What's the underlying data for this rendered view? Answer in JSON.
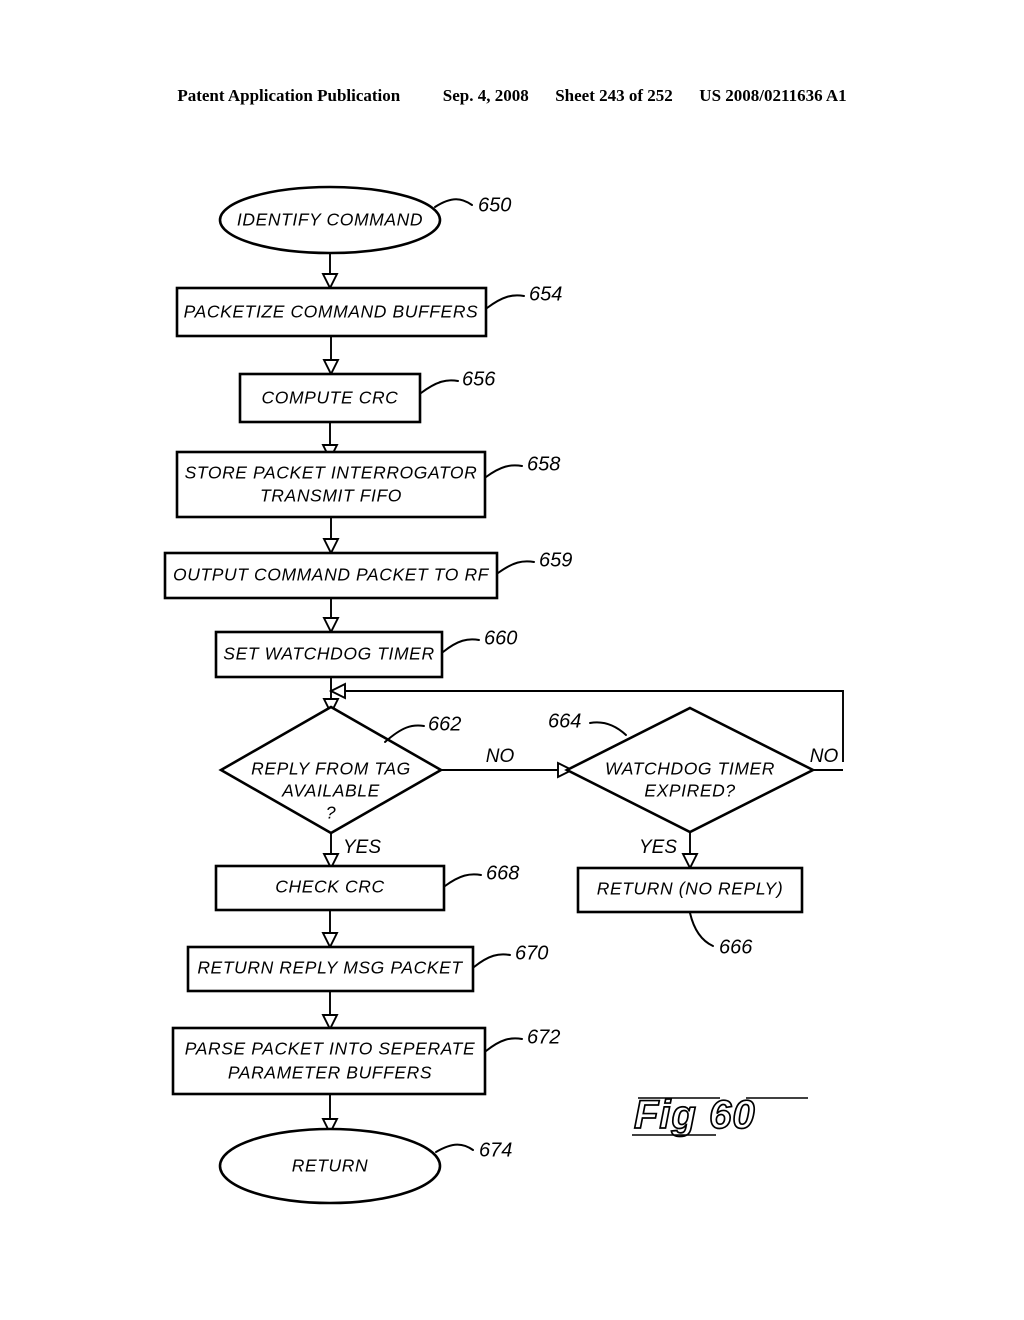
{
  "header": {
    "publication": "Patent Application Publication",
    "date": "Sep. 4, 2008",
    "sheet": "Sheet 243 of 252",
    "patent_number": "US 2008/0211636 A1"
  },
  "figure": {
    "label": "Fig. 60",
    "label_glyphs": "Fig 60"
  },
  "chart_data": {
    "type": "diagram",
    "title": "Fig. 60",
    "diagram_kind": "flowchart",
    "nodes": [
      {
        "id": "650",
        "ref": "650",
        "shape": "oval",
        "text": "IDENTIFY COMMAND"
      },
      {
        "id": "654",
        "ref": "654",
        "shape": "process",
        "text": "PACKETIZE COMMAND BUFFERS"
      },
      {
        "id": "656",
        "ref": "656",
        "shape": "process",
        "text": "COMPUTE CRC"
      },
      {
        "id": "658",
        "ref": "658",
        "shape": "process",
        "text": "STORE PACKET INTERROGATOR TRANSMIT FIFO",
        "line1": "STORE PACKET INTERROGATOR",
        "line2": "TRANSMIT FIFO"
      },
      {
        "id": "659",
        "ref": "659",
        "shape": "process",
        "text": "OUTPUT COMMAND PACKET TO RF"
      },
      {
        "id": "660",
        "ref": "660",
        "shape": "process",
        "text": "SET WATCHDOG TIMER"
      },
      {
        "id": "662",
        "ref": "662",
        "shape": "decision",
        "text": "REPLY FROM TAG AVAILABLE ?",
        "line1": "REPLY FROM TAG",
        "line2": "AVAILABLE",
        "line3": "?"
      },
      {
        "id": "664",
        "ref": "664",
        "shape": "decision",
        "text": "WATCHDOG TIMER EXPIRED?",
        "line1": "WATCHDOG TIMER",
        "line2": "EXPIRED?"
      },
      {
        "id": "666",
        "ref": "666",
        "shape": "process",
        "text": "RETURN (NO REPLY)"
      },
      {
        "id": "668",
        "ref": "668",
        "shape": "process",
        "text": "CHECK CRC"
      },
      {
        "id": "670",
        "ref": "670",
        "shape": "process",
        "text": "RETURN REPLY MSG PACKET"
      },
      {
        "id": "672",
        "ref": "672",
        "shape": "process",
        "text": "PARSE PACKET INTO SEPERATE PARAMETER BUFFERS",
        "line1": "PARSE PACKET INTO SEPERATE",
        "line2": "PARAMETER BUFFERS"
      },
      {
        "id": "674",
        "ref": "674",
        "shape": "oval",
        "text": "RETURN"
      }
    ],
    "edges": [
      {
        "from": "650",
        "to": "654",
        "label": ""
      },
      {
        "from": "654",
        "to": "656",
        "label": ""
      },
      {
        "from": "656",
        "to": "658",
        "label": ""
      },
      {
        "from": "658",
        "to": "659",
        "label": ""
      },
      {
        "from": "659",
        "to": "660",
        "label": ""
      },
      {
        "from": "660",
        "to": "662",
        "label": ""
      },
      {
        "from": "662",
        "to": "668",
        "label": "YES"
      },
      {
        "from": "662",
        "to": "664",
        "label": "NO"
      },
      {
        "from": "664",
        "to": "666",
        "label": "YES"
      },
      {
        "from": "664",
        "to": "662",
        "label": "NO"
      },
      {
        "from": "668",
        "to": "670",
        "label": ""
      },
      {
        "from": "670",
        "to": "672",
        "label": ""
      },
      {
        "from": "672",
        "to": "674",
        "label": ""
      }
    ],
    "branch_labels": {
      "reply_no": "NO",
      "reply_yes": "YES",
      "watchdog_no": "NO",
      "watchdog_yes": "YES"
    }
  }
}
